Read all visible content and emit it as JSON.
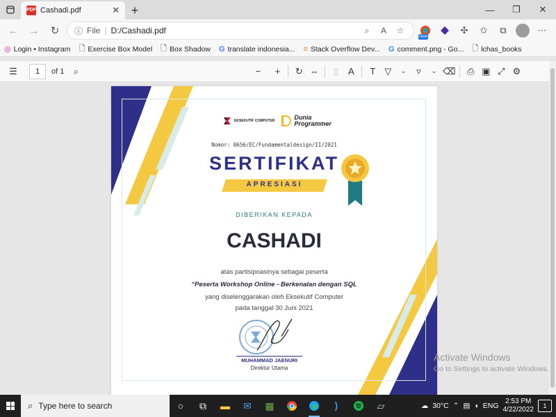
{
  "browser": {
    "tab": {
      "title": "Cashadi.pdf"
    },
    "address": {
      "scheme": "File",
      "url": "D:/Cashadi.pdf"
    },
    "ext_badge": "New",
    "bookmarks": [
      {
        "label": "Login • Instagram",
        "icon": "instagram-icon"
      },
      {
        "label": "Exercise Box Model",
        "icon": "page-icon"
      },
      {
        "label": "Box Shadow",
        "icon": "page-icon"
      },
      {
        "label": "translate indonesia...",
        "icon": "google-icon"
      },
      {
        "label": "Stack Overflow Dev...",
        "icon": "stackoverflow-icon"
      },
      {
        "label": "comment.png - Go...",
        "icon": "google-icon"
      },
      {
        "label": "lchas_books",
        "icon": "page-icon"
      }
    ]
  },
  "pdf_toolbar": {
    "page": "1",
    "of": "of 1"
  },
  "certificate": {
    "logo_left": "EKSEKUTIF COMPUTER",
    "logo_right_1": "Dunia",
    "logo_right_2": "Programmer",
    "nomor": "Nomor: 0656/EC/Fundamentaldesign/II/2021",
    "title": "SERTIFIKAT",
    "subtitle": "APRESIASI",
    "given_to": "DIBERIKAN KEPADA",
    "name": "CASHADI",
    "line1": "atas partisipoasinya sebagai peserta",
    "line2": "“Peserta Workshop Online - Berkenalan dengan SQL",
    "line3": "yang diselenggarakan oleh Eksekutif Computer",
    "line4": "pada tanggal 30 Juni 2021",
    "signer": "MUHAMMAD JAENURI",
    "signer_role": "Direktur Utama",
    "colors": {
      "navy": "#2d2f88",
      "yellow": "#f5c842",
      "teal": "#1e7b82"
    }
  },
  "watermark": {
    "line1": "Activate Windows",
    "line2": "Go to Settings to activate Windows."
  },
  "taskbar": {
    "search_placeholder": "Type here to search",
    "weather": "30°C",
    "lang": "ENG",
    "time": "2:53 PM",
    "date": "4/22/2022",
    "notifications": "1"
  }
}
